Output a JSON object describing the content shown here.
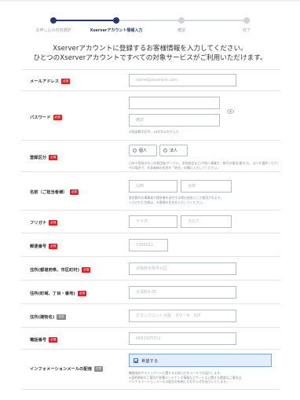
{
  "stepper": {
    "steps": [
      {
        "label": "お申し込み内容選択",
        "state": "done"
      },
      {
        "label": "Xserverアカウント情報入力",
        "state": "active"
      },
      {
        "label": "確認",
        "state": "todo"
      },
      {
        "label": "完了",
        "state": "todo"
      }
    ]
  },
  "lead": {
    "line1": "Xserverアカウントに登録するお客様情報を入力してください。",
    "line2": "ひとつのXserverアカウントですべての対象サービスがご利用いただけます。"
  },
  "badges": {
    "required": "必須",
    "optional": "任意"
  },
  "form": {
    "email": {
      "label": "メールアドレス",
      "placeholder": "name@example.com"
    },
    "password": {
      "label": "パスワード",
      "placeholder": "",
      "confirm_placeholder": "確認",
      "note": "半角英数字記号、16文字以内で入力"
    },
    "registrant_type": {
      "label": "登録区分",
      "options": [
        "個人",
        "法人"
      ],
      "note_line1": "日本で登録のない任意団体(サークル、学校部会など)や個人事業主・商号の場合(屋号)も、法人を選択ください。",
      "note_line2": "その場合で、代表者様の氏名を「姓名」の欄に入力してください。"
    },
    "name": {
      "label": "名前（ご担当者様）",
      "last_placeholder": "山田",
      "first_placeholder": "太郎",
      "note_line1": "東京都内の事業者や請求書を送付する際の宛名として使用されます。",
      "note_line2": "入力された名前は、お客様の氏名を入力してください。"
    },
    "furigana": {
      "label": "フリガナ",
      "last_placeholder": "ヤマダ",
      "first_placeholder": "タロウ"
    },
    "postal": {
      "label": "郵便番号",
      "placeholder": "5300011"
    },
    "address1": {
      "label": "住所(都道府県、市区町村)",
      "placeholder": "大阪府大阪市北区"
    },
    "address2": {
      "label": "住所(町域、丁目・番地)",
      "placeholder": "大深町4-20"
    },
    "address3": {
      "label": "住所(建物名)",
      "placeholder": "グランフロント大阪　タワーA　32F"
    },
    "phone": {
      "label": "電話番号",
      "placeholder": "0662925311"
    },
    "newsletter": {
      "label": "インフォメーションメールの配信",
      "checkbox_label": "希望する",
      "note_line1": "機能強化やキャンペーンに関するお知らせをメールでお届けします。",
      "note_line2": "※契約更新のご案内や各種メンテナンス情報などサービスに関する重要なご案内は",
      "note_line3": "インフォメーションメールの配信の有無にかかわらずお送りいたします。"
    }
  },
  "colors": {
    "primary": "#233a78",
    "required": "#e51e26",
    "check_bg": "#e3eefb"
  }
}
